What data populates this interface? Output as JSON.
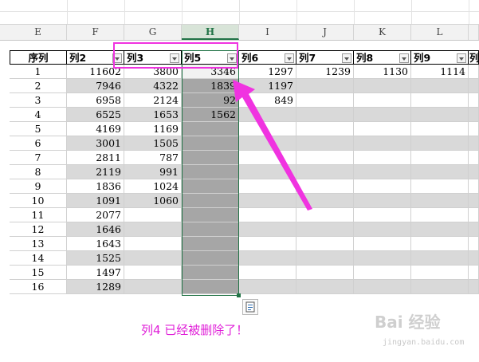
{
  "column_headers": [
    "E",
    "F",
    "G",
    "H",
    "I",
    "J",
    "K",
    "L"
  ],
  "selected_column": "H",
  "table": {
    "headers": [
      "序列",
      "列2",
      "列3",
      "列5",
      "列6",
      "列7",
      "列8",
      "列9",
      "列"
    ],
    "rows": [
      [
        "1",
        "11602",
        "3800",
        "3346",
        "1297",
        "1239",
        "1130",
        "1114"
      ],
      [
        "2",
        "7946",
        "4322",
        "1839",
        "1197",
        "",
        "",
        ""
      ],
      [
        "3",
        "6958",
        "2124",
        "92",
        "849",
        "",
        "",
        ""
      ],
      [
        "4",
        "6525",
        "1653",
        "1562",
        "",
        "",
        "",
        ""
      ],
      [
        "5",
        "4169",
        "1169",
        "",
        "",
        "",
        "",
        ""
      ],
      [
        "6",
        "3001",
        "1505",
        "",
        "",
        "",
        "",
        ""
      ],
      [
        "7",
        "2811",
        "787",
        "",
        "",
        "",
        "",
        ""
      ],
      [
        "8",
        "2119",
        "991",
        "",
        "",
        "",
        "",
        ""
      ],
      [
        "9",
        "1836",
        "1024",
        "",
        "",
        "",
        "",
        ""
      ],
      [
        "10",
        "1091",
        "1060",
        "",
        "",
        "",
        "",
        ""
      ],
      [
        "11",
        "2077",
        "",
        "",
        "",
        "",
        "",
        ""
      ],
      [
        "12",
        "1646",
        "",
        "",
        "",
        "",
        "",
        ""
      ],
      [
        "13",
        "1643",
        "",
        "",
        "",
        "",
        "",
        ""
      ],
      [
        "14",
        "1525",
        "",
        "",
        "",
        "",
        "",
        ""
      ],
      [
        "15",
        "1497",
        "",
        "",
        "",
        "",
        "",
        ""
      ],
      [
        "16",
        "1289",
        "",
        "",
        "",
        "",
        "",
        ""
      ]
    ]
  },
  "annotation": {
    "note": "列4 已经被删除了！",
    "color": "#e020d8"
  },
  "watermark": {
    "text": "Bai 经验",
    "sub": "jingyan.baidu.com"
  },
  "colors": {
    "selection_border": "#217346",
    "selected_fill": "#a6a6a6",
    "banded_fill": "#d9d9d9"
  }
}
